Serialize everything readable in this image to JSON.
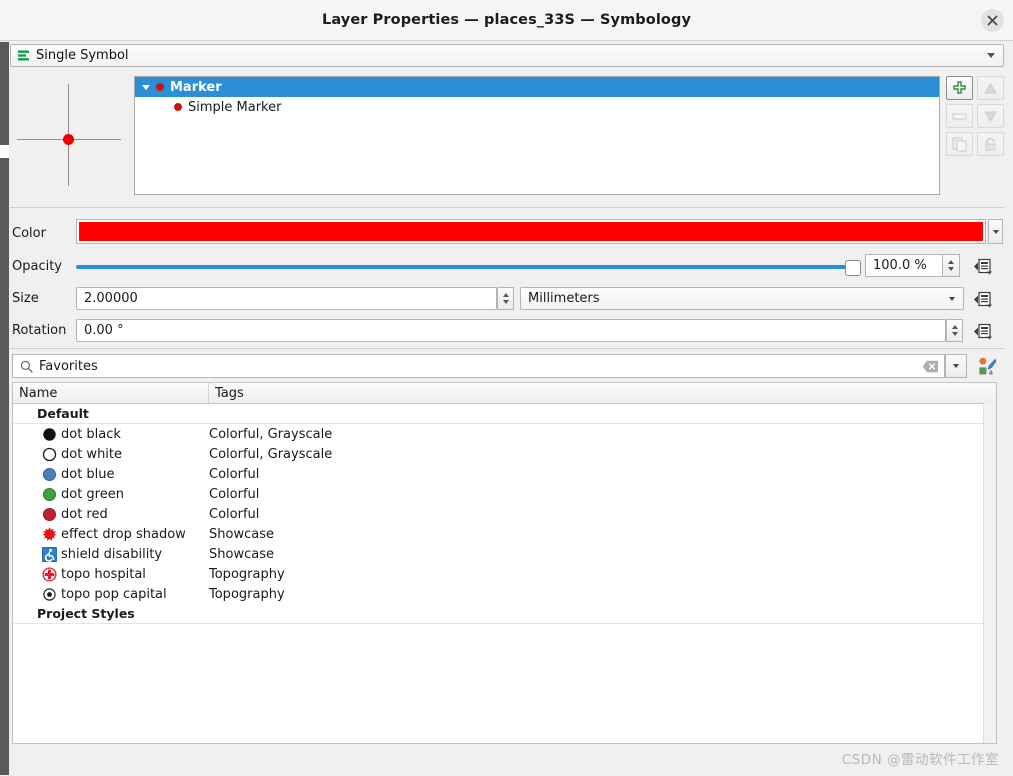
{
  "window": {
    "title": "Layer Properties — places_33S — Symbology",
    "close_icon": "close-icon"
  },
  "renderer": {
    "label": "Single Symbol",
    "icon": "single-symbol-icon"
  },
  "symbol_preview": {
    "dot_color": "#ee0000",
    "icon": "symbol-preview-crosshair"
  },
  "layer_tree": {
    "rows": [
      {
        "label": "Marker",
        "level": 0,
        "selected": true,
        "dot_color": "#cc1111"
      },
      {
        "label": "Simple Marker",
        "level": 1,
        "selected": false,
        "dot_color": "#cc1111"
      }
    ]
  },
  "tree_tools": [
    {
      "name": "add-symbol-layer-button",
      "icon": "plus-icon",
      "enabled": true
    },
    {
      "name": "move-up-button",
      "icon": "arrow-up-icon",
      "enabled": false
    },
    {
      "name": "remove-symbol-layer-button",
      "icon": "minus-icon",
      "enabled": false
    },
    {
      "name": "move-down-button",
      "icon": "arrow-down-icon",
      "enabled": false
    },
    {
      "name": "duplicate-symbol-layer-button",
      "icon": "duplicate-icon",
      "enabled": false
    },
    {
      "name": "lock-layer-button",
      "icon": "lock-icon",
      "enabled": false
    }
  ],
  "properties": {
    "color": {
      "label": "Color",
      "value": "#fe0000"
    },
    "opacity": {
      "label": "Opacity",
      "value": "100.0 %",
      "percent": 100
    },
    "size": {
      "label": "Size",
      "value": "2.00000",
      "units": "Millimeters"
    },
    "rotation": {
      "label": "Rotation",
      "value": "0.00 °"
    },
    "override_icon": "data-defined-override-icon"
  },
  "filter": {
    "text": "Favorites",
    "search_icon": "search-icon",
    "clear_icon": "clear-icon",
    "dropdown_icon": "chevron-down-icon",
    "style_manager_icon": "style-manager-icon"
  },
  "symbol_table": {
    "columns": [
      "Name",
      "Tags"
    ],
    "groups": [
      {
        "label": "Default",
        "rows": [
          {
            "icon": "dot-black-icon",
            "name": "dot  black",
            "tags": "Colorful, Grayscale"
          },
          {
            "icon": "dot-white-icon",
            "name": "dot  white",
            "tags": "Colorful, Grayscale"
          },
          {
            "icon": "dot-blue-icon",
            "name": "dot blue",
            "tags": "Colorful"
          },
          {
            "icon": "dot-green-icon",
            "name": "dot green",
            "tags": "Colorful"
          },
          {
            "icon": "dot-red-icon",
            "name": "dot red",
            "tags": "Colorful"
          },
          {
            "icon": "effect-drop-shadow-icon",
            "name": "effect drop shadow",
            "tags": "Showcase"
          },
          {
            "icon": "shield-disability-icon",
            "name": "shield disability",
            "tags": "Showcase"
          },
          {
            "icon": "topo-hospital-icon",
            "name": "topo hospital",
            "tags": "Topography"
          },
          {
            "icon": "topo-pop-capital-icon",
            "name": "topo pop capital",
            "tags": "Topography"
          }
        ]
      },
      {
        "label": "Project Styles",
        "rows": []
      }
    ]
  },
  "watermark": {
    "text": "CSDN @雷动软件工作室"
  },
  "colors": {
    "accent": "#2a8fd6",
    "marker_red": "#ee0000",
    "dot_black": "#111111",
    "dot_white": "#ffffff",
    "dot_blue": "#4a7fbd",
    "dot_green": "#3fa23f",
    "dot_red": "#c41f33"
  }
}
